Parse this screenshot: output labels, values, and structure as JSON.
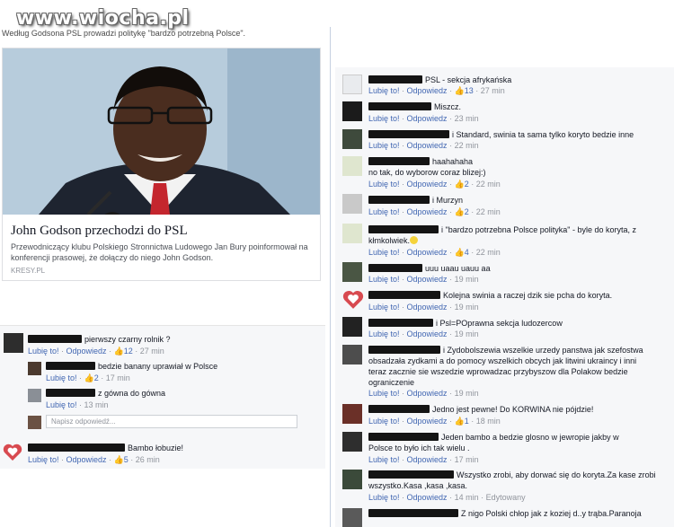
{
  "watermark": "www.wiocha.pl",
  "headline": "Według Godsona PSL prowadzi politykę \"bardzo potrzebną Polsce\".",
  "article": {
    "title": "John Godson przechodzi do PSL",
    "description": "Przewodniczący klubu Polskiego Stronnictwa Ludowego Jan Bury poinformował na konferencji prasowej, że dołączy do niego John Godson.",
    "source": "KRESY.PL"
  },
  "ui": {
    "like": "Lubię to!",
    "reply": "Odpowiedz",
    "thumb": "👍",
    "edited": "Edytowany"
  },
  "left_comments": [
    {
      "text": "pierwszy czarny rolnik ?",
      "likes": "12",
      "time": "27 min"
    },
    {
      "text": "bedzie banany uprawiał w Polsce",
      "likes": "2",
      "time": "17 min"
    },
    {
      "text": "z gówna do gówna",
      "time": "13 min"
    },
    {
      "text": "Bambo łobuzie!",
      "likes": "5",
      "time": "26 min"
    }
  ],
  "reply_placeholder": "Napisz odpowiedź...",
  "right_comments": [
    {
      "text": "PSL - sekcja afrykańska",
      "likes": "13",
      "time": "27 min"
    },
    {
      "text": "Miszcz.",
      "time": "23 min"
    },
    {
      "text": "i Standard, swinia ta sama tylko koryto bedzie inne",
      "time": "22 min"
    },
    {
      "text": "haahahaha",
      "text2": "no tak, do wyborow coraz blizej:)",
      "likes": "2",
      "time": "22 min"
    },
    {
      "text": "i Murzyn",
      "likes": "2",
      "time": "22 min"
    },
    {
      "text": "i \"bardzo potrzebna Polsce polityka\" - byle do koryta, z",
      "text2": "kłmkolwiek.",
      "likes": "4",
      "time": "22 min"
    },
    {
      "text": "uuu uaau uauu aa",
      "time": "19 min"
    },
    {
      "text": "Kolejna swinia a raczej dzik sie pcha do koryta.",
      "time": "19 min"
    },
    {
      "text": "i Psl=POprawna sekcja ludozercow",
      "time": "19 min"
    },
    {
      "text": "i Zydobolszewia wszelkie urzedy panstwa jak szefostwa",
      "text2": "obsadzała zydkami a do pomocy wszelkich obcych jak litwini ukraincy i inni",
      "text3": "teraz zacznie sie wszedzie wprowadzac przybyszow dla Polakow bedzie",
      "text4": "ograniczenie",
      "time": "19 min"
    },
    {
      "text": "Jedno jest pewne! Do KORWINA nie pójdzie!",
      "likes": "1",
      "time": "18 min"
    },
    {
      "text": "Jeden bambo a bedzie glosno w jewropie jakby w",
      "text2": "Polsce to było ich tak wielu .",
      "time": "17 min"
    },
    {
      "text": "Wszystko zrobi, aby dorwać się do koryta.Za kase zrobi",
      "text2": "wszystko.Kasa ,kasa ,kasa.",
      "time": "14 min"
    },
    {
      "text": "Z nigo Polski chłop jak z koziej d..y trąba.Paranoja"
    }
  ],
  "colors": {
    "link": "#4267b2",
    "meta": "#90949c",
    "panel": "#f6f7f9",
    "heart": "#d84a50"
  }
}
